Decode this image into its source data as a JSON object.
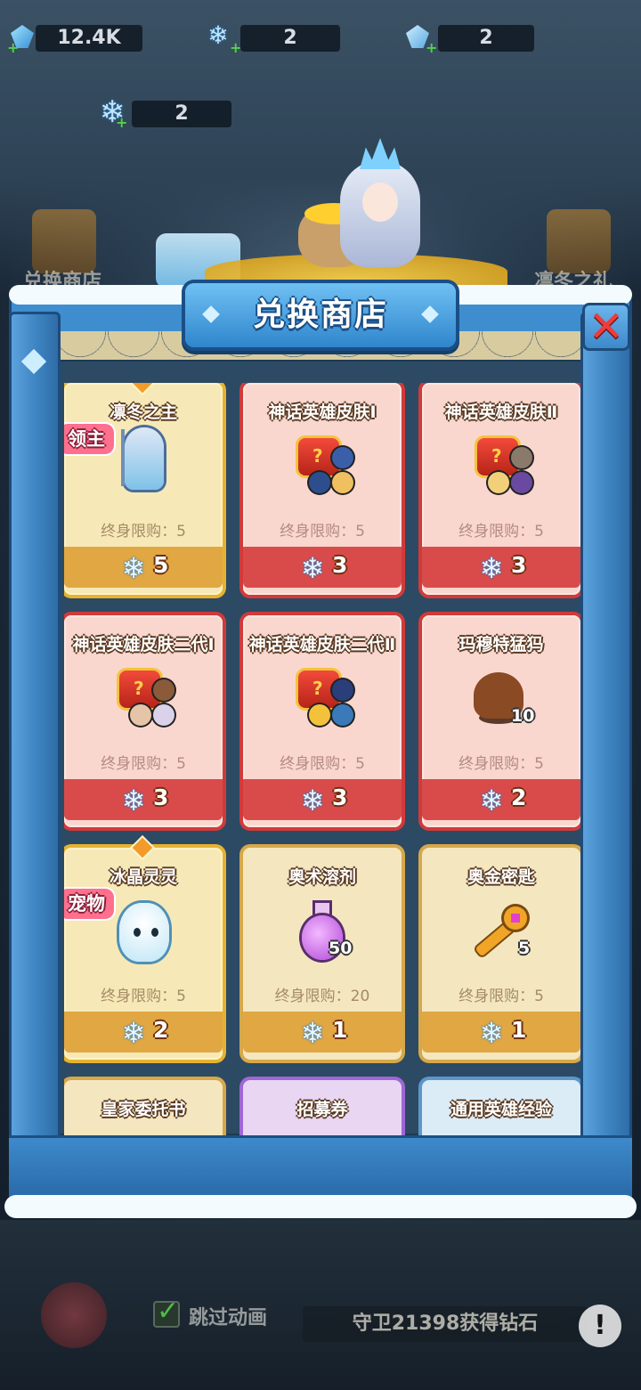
{
  "currency_bar": [
    {
      "icon": "blue-gem-icon",
      "value": "12.4K"
    },
    {
      "icon": "snowflake-icon",
      "value": "2"
    },
    {
      "icon": "ice-shard-icon",
      "value": "2"
    }
  ],
  "shop_currency": {
    "icon": "snowflake-icon",
    "value": "2"
  },
  "side_buttons": {
    "left_label": "兑换商店",
    "right_label": "凛冬之礼"
  },
  "panel": {
    "title": "兑换商店",
    "close_icon": "close-x-icon"
  },
  "cards": [
    {
      "name": "凛冬之主",
      "tag": "领主",
      "limit": "终身限购：5",
      "price": "5",
      "style": "gold",
      "art": "ice-queen-art"
    },
    {
      "name": "神话英雄皮肤Ⅰ",
      "limit": "终身限购：5",
      "price": "3",
      "style": "red",
      "art": "skin-chest-art"
    },
    {
      "name": "神话英雄皮肤Ⅱ",
      "limit": "终身限购：5",
      "price": "3",
      "style": "red",
      "art": "skin-chest-art"
    },
    {
      "name": "神话英雄皮肤二代Ⅰ",
      "limit": "终身限购：5",
      "price": "3",
      "style": "red",
      "art": "skin-chest-art"
    },
    {
      "name": "神话英雄皮肤二代Ⅱ",
      "limit": "终身限购：5",
      "price": "3",
      "style": "red",
      "art": "skin-chest-art"
    },
    {
      "name": "玛穆特猛犸",
      "limit": "终身限购：5",
      "price": "2",
      "qty": "10",
      "style": "red",
      "art": "mammoth-art"
    },
    {
      "name": "冰晶灵灵",
      "tag": "宠物",
      "limit": "终身限购：5",
      "price": "2",
      "style": "gold",
      "art": "ice-spirit-art"
    },
    {
      "name": "奥术溶剂",
      "limit": "终身限购：20",
      "price": "1",
      "qty": "50",
      "style": "plain",
      "art": "potion-art"
    },
    {
      "name": "奥金密匙",
      "limit": "终身限购：5",
      "price": "1",
      "qty": "5",
      "style": "plain",
      "art": "key-art"
    },
    {
      "name": "皇家委托书",
      "style": "plain"
    },
    {
      "name": "招募券",
      "style": "purple"
    },
    {
      "name": "通用英雄经验",
      "style": "blue"
    }
  ],
  "hud": {
    "skip_label": "跳过动画",
    "message": "守卫21398获得钻石",
    "info_icon": "!"
  }
}
